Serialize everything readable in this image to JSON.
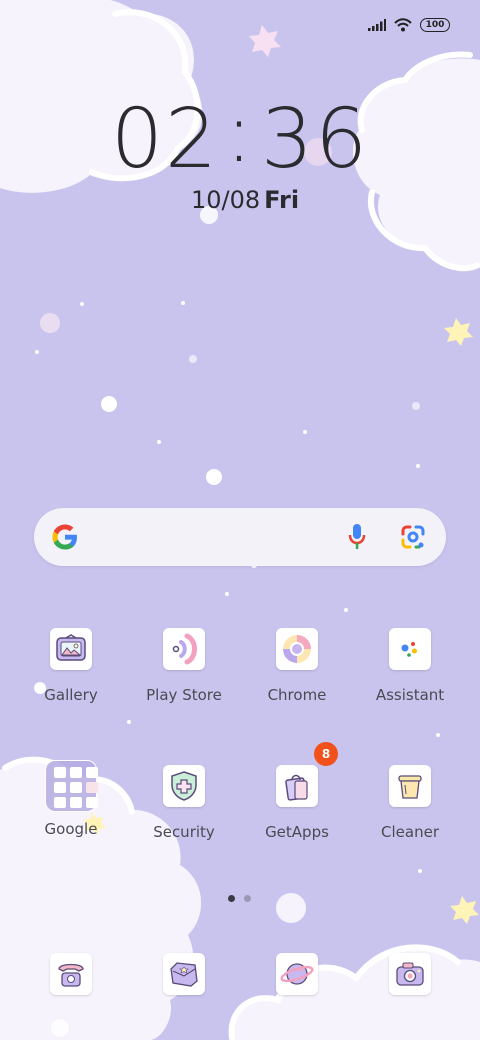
{
  "status_bar": {
    "battery": "100",
    "signal_icon": "signal-bars-icon",
    "wifi_icon": "wifi-icon"
  },
  "clock": {
    "hours": "02",
    "separator": ":",
    "minutes": "36"
  },
  "date": {
    "day": "10/08",
    "weekday": "Fri"
  },
  "search_widget": {
    "logo_icon": "google-g-icon",
    "voice_icon": "microphone-icon",
    "lens_icon": "google-lens-icon"
  },
  "apps": [
    {
      "label": "Gallery",
      "icon": "gallery-icon"
    },
    {
      "label": "Play Store",
      "icon": "play-store-icon"
    },
    {
      "label": "Chrome",
      "icon": "chrome-icon"
    },
    {
      "label": "Assistant",
      "icon": "assistant-icon"
    },
    {
      "label": "Google",
      "icon": "folder-icon"
    },
    {
      "label": "Security",
      "icon": "security-icon"
    },
    {
      "label": "GetApps",
      "icon": "getapps-icon",
      "badge": "8"
    },
    {
      "label": "Cleaner",
      "icon": "cleaner-icon"
    }
  ],
  "page_indicator": {
    "pages": 2,
    "current": 1
  },
  "dock": [
    {
      "icon": "phone-icon"
    },
    {
      "icon": "messages-icon"
    },
    {
      "icon": "browser-icon"
    },
    {
      "icon": "camera-icon"
    }
  ],
  "colors": {
    "background": "#c9c4ee",
    "cloud": "#f6f3fc",
    "badge": "#f2511b",
    "star": "#fff4b8"
  }
}
